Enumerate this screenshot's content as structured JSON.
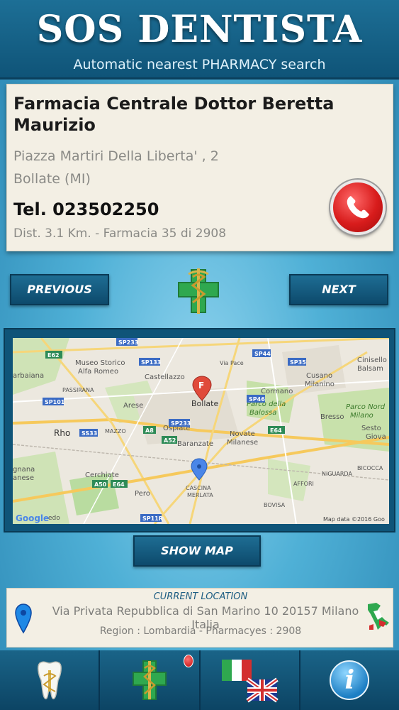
{
  "header": {
    "title": "SOS DENTISTA",
    "subtitle": "Automatic nearest PHARMACY search"
  },
  "pharmacy": {
    "name": "Farmacia Centrale Dottor Beretta Maurizio",
    "street": "Piazza Martiri Della Liberta' , 2",
    "city": "Bollate (MI)",
    "phone": "Tel. 023502250",
    "distance": "Dist. 3.1 Km. - Farmacia 35 di 2908",
    "call_icon": "phone-call-icon"
  },
  "nav": {
    "previous_label": "PREVIOUS",
    "next_label": "NEXT",
    "logo_icon": "pharmacy-cross-caduceus-icon"
  },
  "map": {
    "labels": {
      "museo": "Museo Storico",
      "alfa": "Alfa Romeo",
      "castellazzo": "Castellazzo",
      "arese": "Arese",
      "ospiate": "Ospiate",
      "bollate": "Bollate",
      "cormano": "Cormano",
      "cusano": "Cusano",
      "milanino": "Milanino",
      "cinisello": "Cinisello",
      "balsamo": "Balsam",
      "parco_balossa_1": "Parco della",
      "parco_balossa_2": "Balossa",
      "parco_nord_1": "Parco Nord",
      "parco_nord_2": "Milano",
      "bresso": "Bresso",
      "sesto": "Sesto",
      "giova": "Giova",
      "rho": "Rho",
      "mazzo": "MAZZO",
      "baranzate": "Baranzate",
      "novate_1": "Novate",
      "novate_2": "Milanese",
      "cerchiate": "Cerchiate",
      "pero": "Pero",
      "cascina": "CASCINA",
      "merlata": "MERLATA",
      "passirana": "PASSIRANA",
      "barbaiana": "arbaiana",
      "gnana": "gnana",
      "anese": "anese",
      "niguarda": "NIGUARDA",
      "bicocca": "BICOCCA",
      "affori": "AFFORI",
      "bovisa": "BOVISA",
      "via_pace": "Via Pace",
      "sp233a": "SP233",
      "sp133": "SP133",
      "sp44": "SP44",
      "sp35": "SP35",
      "e62": "E62",
      "sp101": "SP101",
      "ss33": "SS33",
      "a8": "A8",
      "a52": "A52",
      "sp233b": "SP233",
      "sp46": "SP46",
      "e64": "E64",
      "a50": "A50",
      "e64b": "E64",
      "sp11r": "SP11R",
      "google": "Google",
      "google_suffix": "edo",
      "attribution": "Map data ©2016 Goo"
    },
    "show_map_label": "SHOW MAP",
    "pharmacy_marker_letter": "F"
  },
  "location": {
    "heading": "CURRENT LOCATION",
    "address": "Via Privata Repubblica di San Marino 10 20157 Milano Italia",
    "region": "Region : Lombardia - Pharmacyes : 2908"
  },
  "tabs": [
    {
      "icon": "tooth-icon"
    },
    {
      "icon": "pharmacy-cross-icon"
    },
    {
      "icon": "language-flags-icon"
    },
    {
      "icon": "info-icon",
      "glyph": "i"
    }
  ],
  "colors": {
    "header_bg": "#0f5478",
    "card_bg": "#f3efe4",
    "call_red": "#d81c1c",
    "cross_green": "#2fa84f"
  }
}
